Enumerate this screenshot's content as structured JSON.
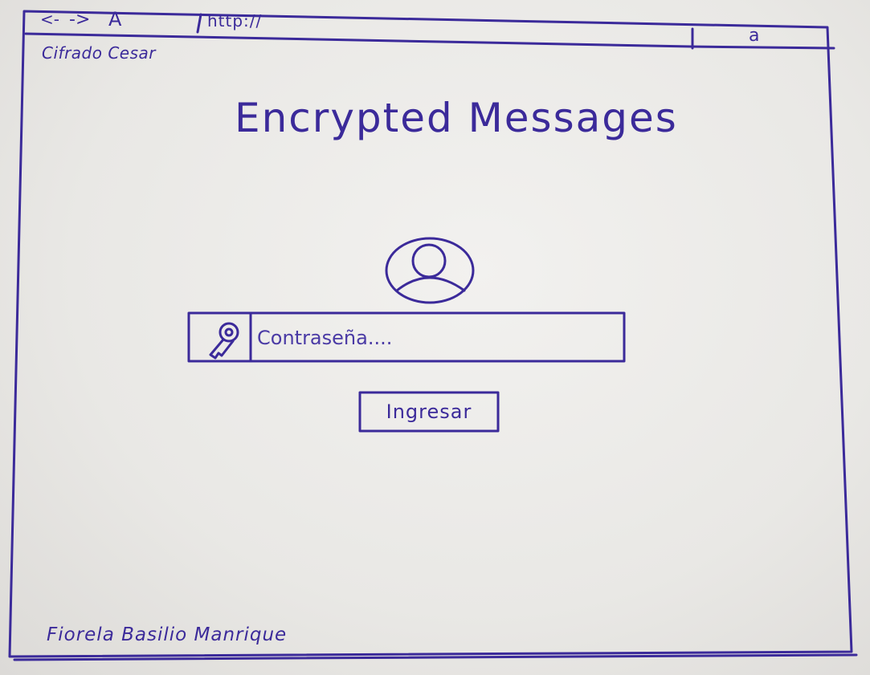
{
  "browser": {
    "back_glyph": "<-",
    "forward_glyph": "->",
    "home_glyph": "A",
    "url": "http://",
    "search_glyph": "a"
  },
  "site": {
    "title": "Cifrado Cesar"
  },
  "main": {
    "heading": "Encrypted Messages",
    "password_placeholder": "Contraseña....",
    "submit_label": "Ingresar"
  },
  "footer": {
    "author": "Fiorela Basilio Manrique"
  },
  "colors": {
    "ink": "#3b2a9a",
    "paper": "#eeedea"
  },
  "icons": [
    "user-avatar-icon",
    "key-icon"
  ]
}
